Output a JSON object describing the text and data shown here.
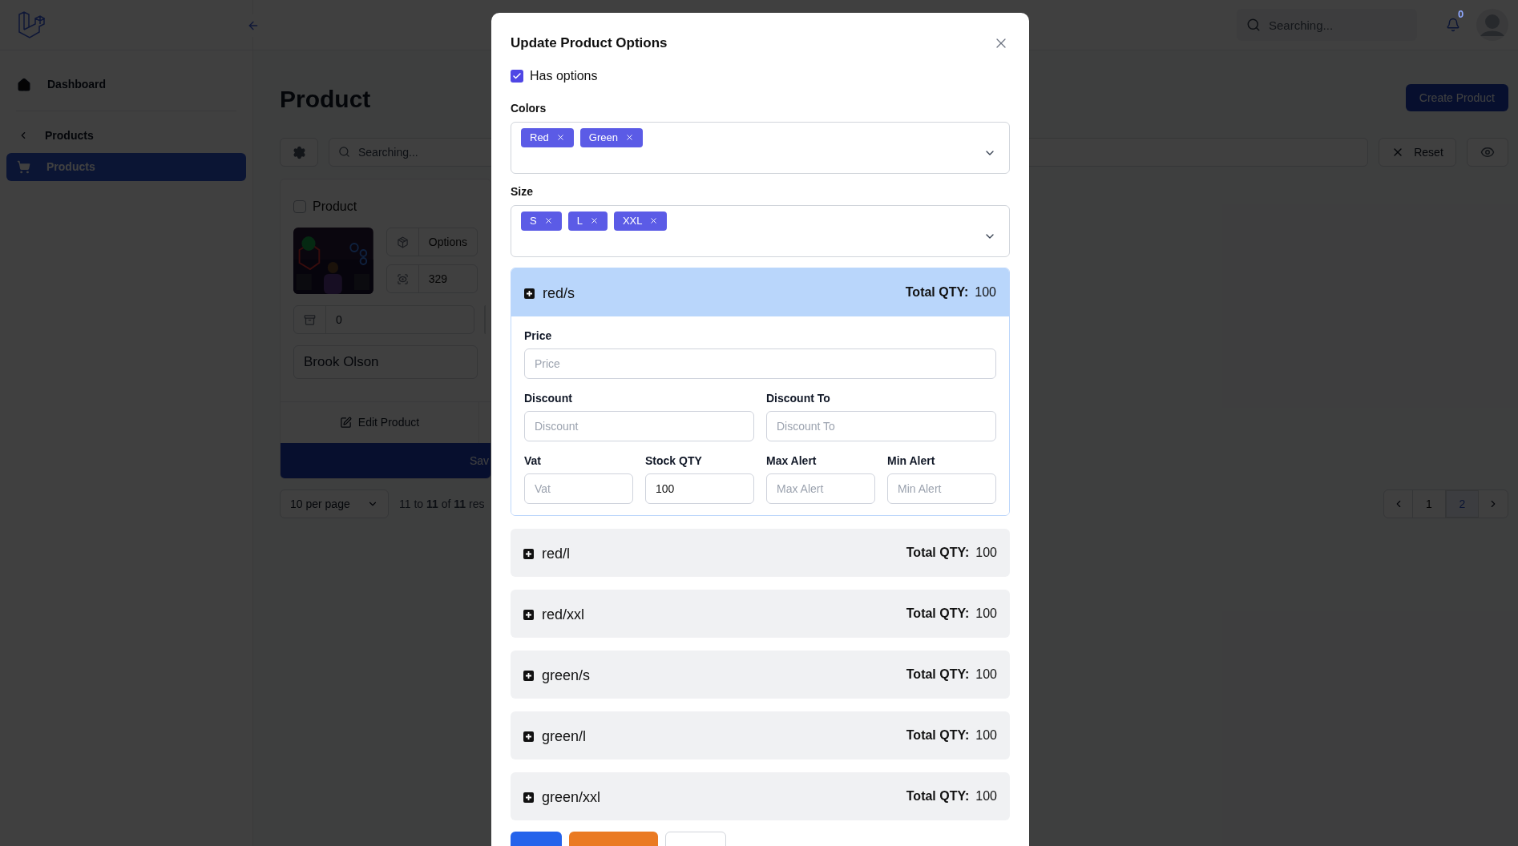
{
  "topbar": {
    "search_placeholder": "Searching...",
    "notification_count": "0"
  },
  "sidebar": {
    "items": [
      {
        "kind": "link",
        "label": "Dashboard",
        "selected": false
      },
      {
        "kind": "group",
        "label": "Products",
        "children": [
          {
            "label": "Products",
            "selected": true
          }
        ]
      }
    ]
  },
  "page": {
    "title": "Product",
    "create_button": "Create Product",
    "search_placeholder": "Searching...",
    "reset_button": "Reset",
    "card": {
      "select_label": "Product",
      "selected": false,
      "fields": [
        {
          "kind": "options",
          "value": "Options"
        },
        {
          "kind": "views",
          "value": "329"
        }
      ],
      "stock": "0",
      "owner": "Brook Olson",
      "edit_button": "Edit Product",
      "save_button": "Sav"
    },
    "pagination": {
      "per_page": "10 per page",
      "summary": "11 to **11** of **11** res",
      "pages": [
        {
          "label": "1",
          "selected": false
        },
        {
          "label": "2",
          "selected": true
        }
      ]
    }
  },
  "modal": {
    "title": "Update Product Options",
    "has_options": {
      "label": "Has options",
      "checked": true
    },
    "selects": [
      {
        "label": "Colors",
        "tags": [
          "Red",
          "Green"
        ]
      },
      {
        "label": "Size",
        "tags": [
          "S",
          "L",
          "XXL"
        ]
      }
    ],
    "variants": [
      {
        "name": "red/s",
        "total_label": "Total QTY:",
        "total": "100",
        "expanded": true,
        "fields": [
          {
            "kind": "full",
            "label": "Price",
            "placeholder": "Price"
          },
          {
            "kind": "half",
            "label": "Discount",
            "placeholder": "Discount"
          },
          {
            "kind": "half",
            "label": "Discount To",
            "placeholder": "Discount To"
          },
          {
            "kind": "quarter",
            "label": "Vat",
            "placeholder": "Vat"
          },
          {
            "kind": "quarter",
            "label": "Stock QTY",
            "value": "100"
          },
          {
            "kind": "quarter",
            "label": "Max Alert",
            "placeholder": "Max Alert"
          },
          {
            "kind": "quarter",
            "label": "Min Alert",
            "placeholder": "Min Alert"
          }
        ]
      },
      {
        "name": "red/l",
        "total_label": "Total QTY:",
        "total": "100",
        "expanded": false
      },
      {
        "name": "red/xxl",
        "total_label": "Total QTY:",
        "total": "100",
        "expanded": false
      },
      {
        "name": "green/s",
        "total_label": "Total QTY:",
        "total": "100",
        "expanded": false
      },
      {
        "name": "green/l",
        "total_label": "Total QTY:",
        "total": "100",
        "expanded": false
      },
      {
        "name": "green/xxl",
        "total_label": "Total QTY:",
        "total": "100",
        "expanded": false
      }
    ],
    "footer_buttons": [
      {
        "kind": "primary"
      },
      {
        "kind": "warning"
      },
      {
        "kind": "outline"
      }
    ]
  }
}
